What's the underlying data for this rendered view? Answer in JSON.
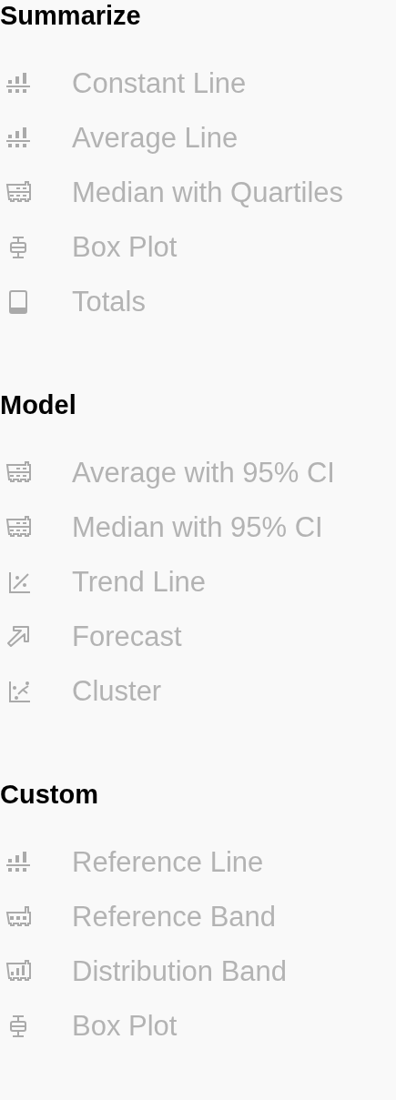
{
  "sections": [
    {
      "title": "Summarize",
      "items": [
        {
          "label": "Constant Line",
          "kind": "bars-line"
        },
        {
          "label": "Average Line",
          "kind": "bars-line"
        },
        {
          "label": "Median with Quartiles",
          "kind": "band"
        },
        {
          "label": "Box Plot",
          "kind": "boxplot"
        },
        {
          "label": "Totals",
          "kind": "totals"
        }
      ]
    },
    {
      "title": "Model",
      "items": [
        {
          "label": "Average with 95% CI",
          "kind": "band"
        },
        {
          "label": "Median with 95% CI",
          "kind": "band"
        },
        {
          "label": "Trend Line",
          "kind": "trend"
        },
        {
          "label": "Forecast",
          "kind": "forecast"
        },
        {
          "label": "Cluster",
          "kind": "cluster"
        }
      ]
    },
    {
      "title": "Custom",
      "items": [
        {
          "label": "Reference Line",
          "kind": "bars-line"
        },
        {
          "label": "Reference Band",
          "kind": "ref-band"
        },
        {
          "label": "Distribution Band",
          "kind": "dist-band"
        },
        {
          "label": "Box Plot",
          "kind": "boxplot"
        }
      ]
    }
  ]
}
